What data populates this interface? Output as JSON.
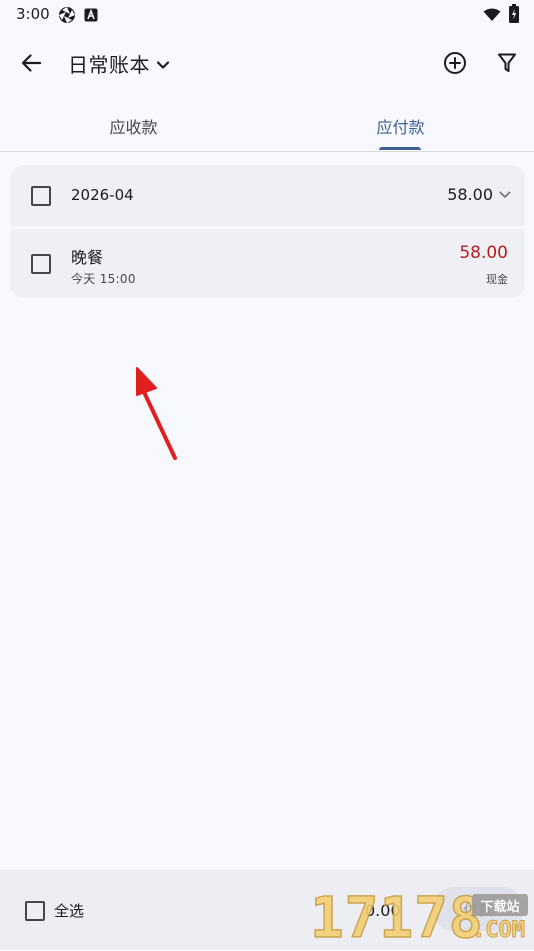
{
  "status_bar": {
    "time": "3:00"
  },
  "app_bar": {
    "title": "日常账本"
  },
  "tabs": [
    {
      "label": "应收款",
      "selected": false
    },
    {
      "label": "应付款",
      "selected": true
    }
  ],
  "group": {
    "month": "2026-04",
    "total": "58.00"
  },
  "items": [
    {
      "name": "晚餐",
      "time": "今天 15:00",
      "amount": "58.00",
      "method": "现金"
    }
  ],
  "bottom_bar": {
    "select_all_label": "全选",
    "total": "0.00",
    "pay_button_label": "付款"
  },
  "watermark": {
    "digits": "17178",
    "badge": "下载站",
    "domain": ".COM"
  },
  "colors": {
    "accent": "#3f5f90",
    "amount_negative": "#ba1a1a",
    "background": "#f8f9ff",
    "card": "#eff0f5",
    "annotation_arrow": "#e02020"
  }
}
